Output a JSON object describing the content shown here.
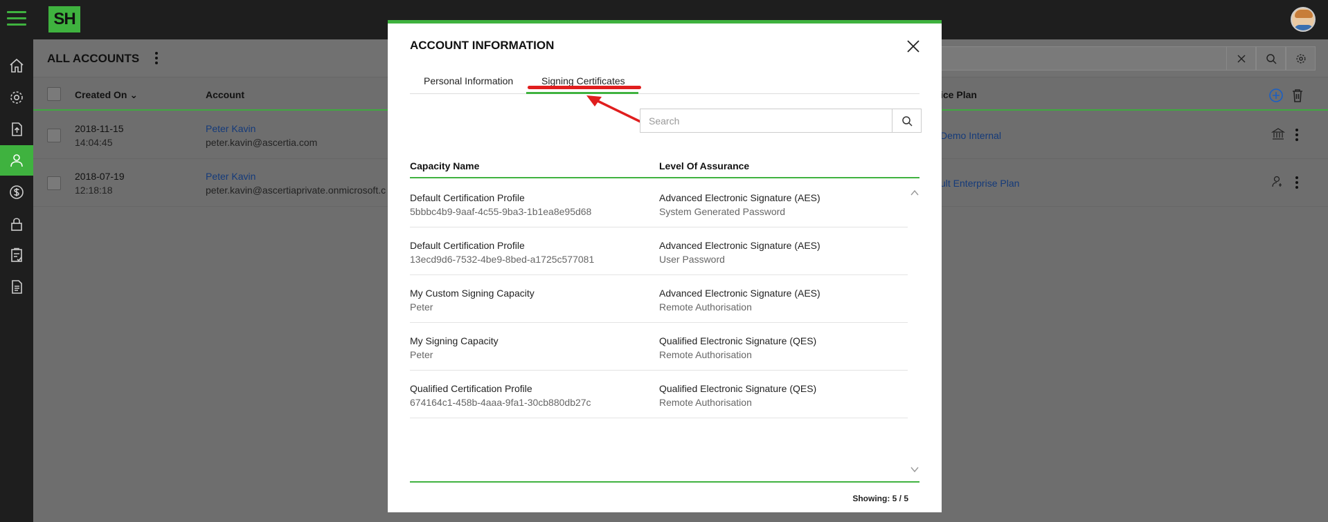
{
  "app": {
    "logo_text": "SH"
  },
  "page": {
    "title": "ALL ACCOUNTS",
    "columns": {
      "created_on": "Created On",
      "account": "Account",
      "plan": "ice Plan"
    },
    "rows": [
      {
        "date": "2018-11-15",
        "time": "14:04:45",
        "name": "Peter Kavin",
        "email": "peter.kavin@ascertia.com",
        "plan": "Demo Internal"
      },
      {
        "date": "2018-07-19",
        "time": "12:18:18",
        "name": "Peter Kavin",
        "email": "peter.kavin@ascertiaprivate.onmicrosoft.c",
        "plan": "ult Enterprise Plan"
      }
    ]
  },
  "modal": {
    "title": "ACCOUNT INFORMATION",
    "tabs": [
      {
        "label": "Personal Information",
        "active": false
      },
      {
        "label": "Signing Certificates",
        "active": true
      }
    ],
    "search": {
      "placeholder": "Search",
      "value": ""
    },
    "columns": {
      "capacity_name": "Capacity Name",
      "level_of_assurance": "Level Of Assurance"
    },
    "rows": [
      {
        "name": "Default Certification Profile",
        "sub": "5bbbc4b9-9aaf-4c55-9ba3-1b1ea8e95d68",
        "level": "Advanced Electronic Signature (AES)",
        "auth": "System Generated Password"
      },
      {
        "name": "Default Certification Profile",
        "sub": "13ecd9d6-7532-4be9-8bed-a1725c577081",
        "level": "Advanced Electronic Signature (AES)",
        "auth": "User Password"
      },
      {
        "name": "My Custom Signing Capacity",
        "sub": "Peter",
        "level": "Advanced Electronic Signature (AES)",
        "auth": "Remote Authorisation"
      },
      {
        "name": "My Signing Capacity",
        "sub": "Peter",
        "level": "Qualified Electronic Signature (QES)",
        "auth": "Remote Authorisation"
      },
      {
        "name": "Qualified Certification Profile",
        "sub": "674164c1-458b-4aaa-9fa1-30cb880db27c",
        "level": "Qualified Electronic Signature (QES)",
        "auth": "Remote Authorisation"
      }
    ],
    "showing": "Showing: 5 / 5"
  },
  "colors": {
    "accent": "#3fb23f",
    "annotation": "#e01e1e",
    "link": "#1a5fc4"
  }
}
